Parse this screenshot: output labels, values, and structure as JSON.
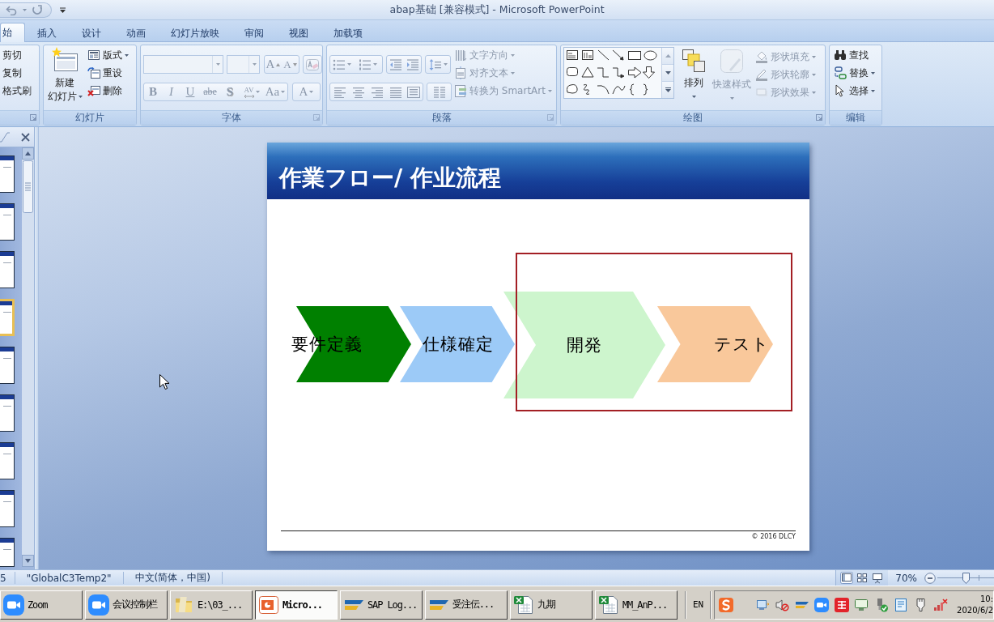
{
  "window": {
    "title": "abap基础 [兼容模式] - Microsoft PowerPoint"
  },
  "tabs": [
    {
      "label": "始",
      "selected": true
    },
    {
      "label": "插入",
      "selected": false
    },
    {
      "label": "设计",
      "selected": false
    },
    {
      "label": "动画",
      "selected": false
    },
    {
      "label": "幻灯片放映",
      "selected": false
    },
    {
      "label": "审阅",
      "selected": false
    },
    {
      "label": "视图",
      "selected": false
    },
    {
      "label": "加载项",
      "selected": false
    }
  ],
  "ribbon": {
    "groups": [
      {
        "kind": "clipboard",
        "disabled": false,
        "items": [
          {
            "label": "剪切"
          },
          {
            "label": "复制"
          },
          {
            "label": "格式刷"
          }
        ]
      },
      {
        "kind": "slides",
        "label": "幻灯片",
        "disabled": false,
        "new_slide": {
          "lines": [
            "新建",
            "幻灯片"
          ],
          "dropdown": true
        },
        "items": [
          {
            "label": "版式",
            "dropdown": true
          },
          {
            "label": "重设",
            "dropdown": false
          },
          {
            "label": "删除",
            "dropdown": false
          }
        ]
      },
      {
        "kind": "font",
        "label": "字体",
        "disabled": true,
        "size_buttons": [
          {
            "glyph": "A",
            "kind": "grow"
          },
          {
            "glyph": "A",
            "kind": "shrink"
          }
        ],
        "format_buttons": [
          {
            "glyph": "B",
            "kind": "bold"
          },
          {
            "glyph": "I",
            "kind": "italic"
          },
          {
            "glyph": "U",
            "kind": "underline"
          },
          {
            "glyph": "abe",
            "kind": "strikethrough"
          },
          {
            "glyph": "S",
            "kind": "shadow"
          },
          {
            "glyph": "AV",
            "kind": "spacing"
          },
          {
            "glyph": "Aa",
            "kind": "case"
          }
        ],
        "color_button": {
          "glyph": "A"
        }
      },
      {
        "kind": "paragraph",
        "label": "段落",
        "disabled": true,
        "items": [
          {
            "label": "文字方向",
            "dropdown": true
          },
          {
            "label": "对齐文本",
            "dropdown": true
          },
          {
            "label": "转换为 SmartArt",
            "dropdown": true
          }
        ]
      },
      {
        "kind": "drawing",
        "label": "绘图",
        "disabled": false,
        "large_buttons": [
          {
            "label": "排列",
            "kind": "arrange",
            "disabled": false,
            "dropdown": true
          },
          {
            "label": "快速样式",
            "kind": "quick_styles",
            "disabled": true,
            "dropdown": true
          }
        ],
        "items": [
          {
            "label": "形状填充",
            "kind": "fill",
            "disabled": true,
            "dropdown": true
          },
          {
            "label": "形状轮廓",
            "kind": "outline",
            "disabled": true,
            "dropdown": true
          },
          {
            "label": "形状效果",
            "kind": "effects",
            "disabled": true,
            "dropdown": true
          }
        ]
      },
      {
        "kind": "editing",
        "label": "编辑",
        "disabled": false,
        "items": [
          {
            "label": "查找",
            "kind": "find",
            "dropdown": false
          },
          {
            "label": "替换",
            "kind": "replace",
            "dropdown": true
          },
          {
            "label": "选择",
            "kind": "select",
            "dropdown": true
          }
        ]
      }
    ]
  },
  "slides_pane": {
    "thumbnails": [
      {
        "selected": false
      },
      {
        "selected": false
      },
      {
        "selected": false
      },
      {
        "selected": true
      },
      {
        "selected": false
      },
      {
        "selected": false
      },
      {
        "selected": false
      },
      {
        "selected": false
      },
      {
        "selected": false
      }
    ]
  },
  "slide": {
    "title": "作業フロー/ 作业流程",
    "steps": [
      {
        "label": "要件定義",
        "color": "#008000",
        "framed": false
      },
      {
        "label": "仕様確定",
        "color": "#9ccaf7",
        "framed": false
      },
      {
        "label": "開発",
        "color": "#cdf5cd",
        "framed": true
      },
      {
        "label": "テスト",
        "color": "#f9c89b",
        "framed": true
      }
    ],
    "footer": "© 2016 DLCY"
  },
  "status_bar": {
    "fields": [
      "5",
      "\"GlobalC3Temp2\"",
      "中文(简体，中国)"
    ],
    "views": [
      {
        "kind": "normal",
        "selected": true
      },
      {
        "kind": "sorter",
        "selected": false
      },
      {
        "kind": "slideshow",
        "selected": false
      }
    ],
    "zoom": {
      "label": "70%",
      "level": 0.5
    }
  },
  "taskbar": {
    "buttons": [
      {
        "kind": "zoom",
        "label": "Zoom",
        "selected": false
      },
      {
        "kind": "zoom",
        "label": "会议控制栏",
        "selected": false
      },
      {
        "kind": "folder",
        "label": "E:\\03_...",
        "selected": false
      },
      {
        "kind": "powerpoint",
        "label": "Micro...",
        "selected": true
      },
      {
        "kind": "sap",
        "label": "SAP Log...",
        "selected": false
      },
      {
        "kind": "sap",
        "label": "受注伝...",
        "selected": false
      },
      {
        "kind": "excel",
        "label": "九期",
        "selected": false
      },
      {
        "kind": "excel",
        "label": "MM_AnP...",
        "selected": false
      }
    ],
    "language": "EN",
    "clock": {
      "time": "10:",
      "date": "2020/6/2"
    }
  }
}
